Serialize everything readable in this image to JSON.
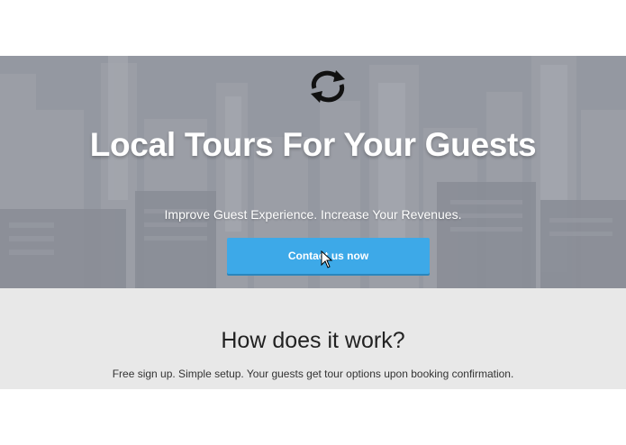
{
  "hero": {
    "logo_icon": "circular-arrows-icon",
    "title": "Local Tours For Your Guests",
    "subtitle": "Improve Guest Experience. Increase Your Revenues.",
    "cta_label": "Contact us now",
    "cta_color": "#3da9e8",
    "background_color": "#8e939c"
  },
  "how_it_works": {
    "title": "How does it work?",
    "text": "Free sign up. Simple setup. Your guests get tour options upon booking confirmation.",
    "background_color": "#e8e8e8"
  }
}
